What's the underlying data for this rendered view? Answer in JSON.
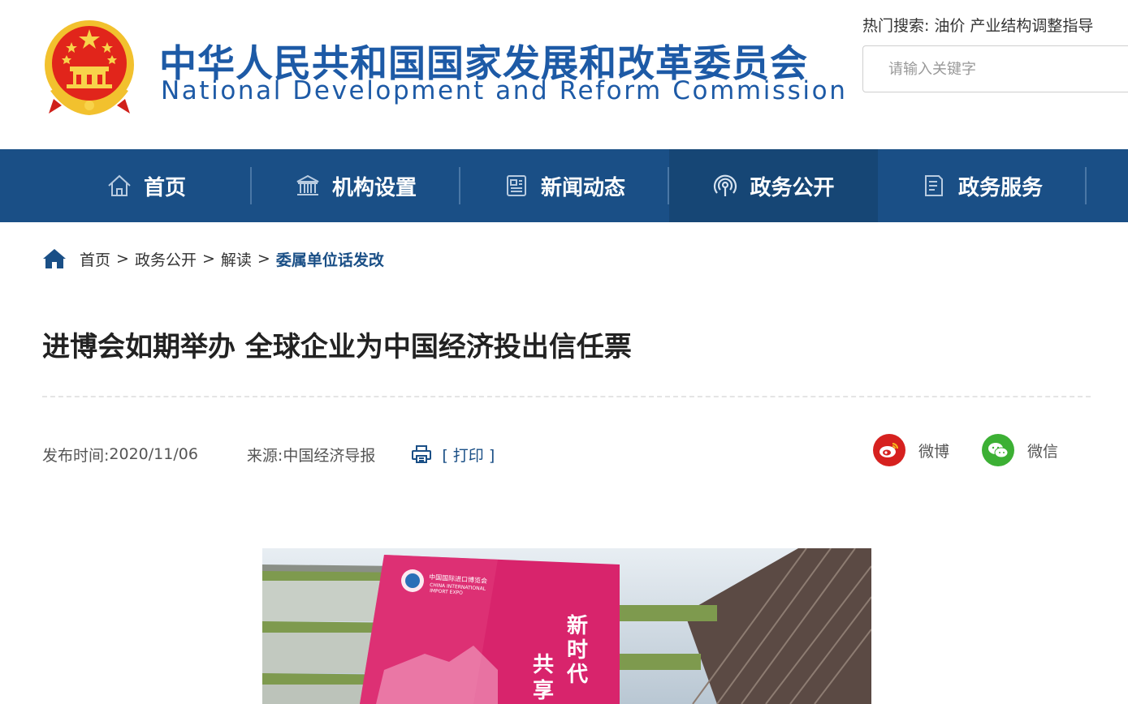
{
  "header": {
    "title_cn": "中华人民共和国国家发展和改革委员会",
    "title_en": "National Development and Reform Commission",
    "hot_search_label": "热门搜索:",
    "hot_search_items": [
      "油价",
      "产业结构调整指导"
    ],
    "search_placeholder": "请输入关键字"
  },
  "nav": {
    "items": [
      {
        "label": "首页",
        "icon": "home-icon"
      },
      {
        "label": "机构设置",
        "icon": "institution-icon"
      },
      {
        "label": "新闻动态",
        "icon": "news-icon"
      },
      {
        "label": "政务公开",
        "icon": "broadcast-icon",
        "active": true
      },
      {
        "label": "政务服务",
        "icon": "document-icon"
      }
    ]
  },
  "breadcrumb": {
    "items": [
      "首页",
      "政务公开",
      "解读"
    ],
    "current": "委属单位话发改",
    "separator": ">"
  },
  "article": {
    "title": "进博会如期举办 全球企业为中国经济投出信任票",
    "publish_label": "发布时间:",
    "publish_date": "2020/11/06",
    "source_label": "来源:",
    "source": "中国经济导报",
    "print_label": "[ 打印 ]",
    "photo_text": {
      "banner_cn": "中国国际进口博览会",
      "banner_en_1": "CHINA INTERNATIONAL",
      "banner_en_2": "IMPORT EXPO",
      "slogan_1": "新",
      "slogan_2": "时",
      "slogan_3": "代",
      "slogan_4": "共",
      "slogan_5": "享"
    }
  },
  "share": {
    "weibo_label": "微博",
    "wechat_label": "微信"
  },
  "colors": {
    "brand_blue": "#1a4f86",
    "nav_active": "#164675",
    "title_blue": "#1d5aa6",
    "weibo_red": "#d6211f",
    "wechat_green": "#3cb034",
    "banner_magenta": "#d8246c"
  }
}
